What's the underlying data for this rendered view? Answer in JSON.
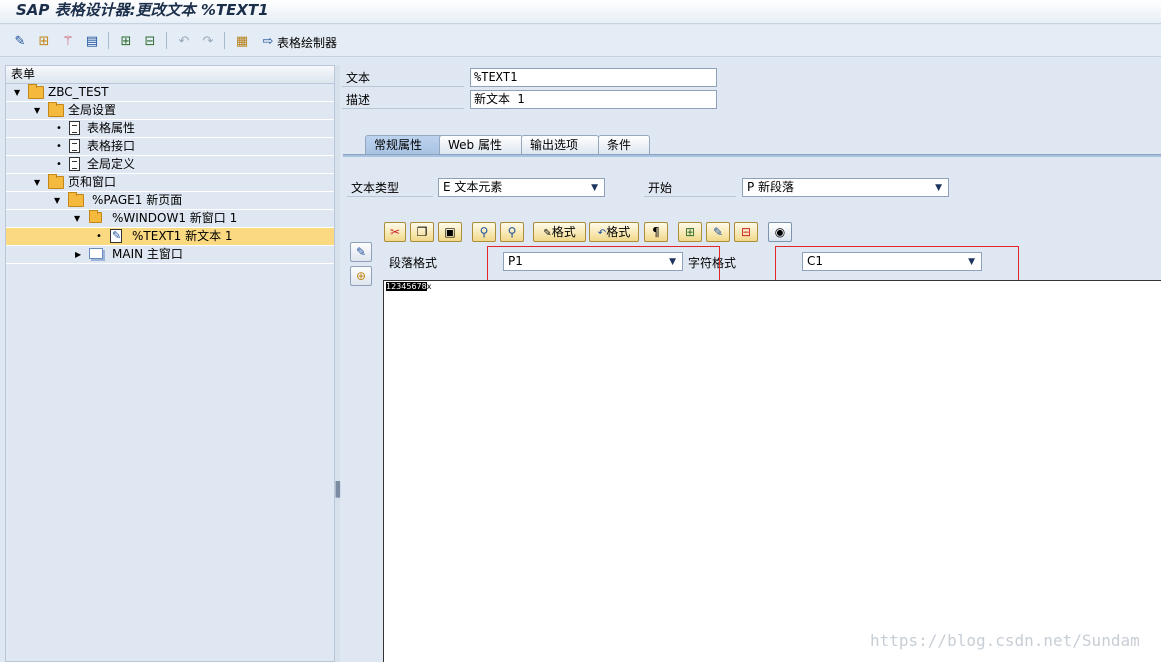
{
  "window": {
    "title": "SAP 表格设计器:更改文本 %TEXT1"
  },
  "toolbar": {
    "icons": [
      "change-icon",
      "hierarchy-icon",
      "magic-wand-icon",
      "print-preview-icon",
      "expand-icon",
      "collapse-icon",
      "undo-icon",
      "redo-icon",
      "field-list-icon"
    ],
    "form_painter_label": "表格绘制器"
  },
  "tree": {
    "header": "表单",
    "nodes": [
      {
        "label": "ZBC_TEST"
      },
      {
        "label": "全局设置"
      },
      {
        "label": "表格属性"
      },
      {
        "label": "表格接口"
      },
      {
        "label": "全局定义"
      },
      {
        "label": "页和窗口"
      },
      {
        "label": "%PAGE1 新页面"
      },
      {
        "label": "%WINDOW1 新窗口 1"
      },
      {
        "label": "%TEXT1 新文本 1"
      },
      {
        "label": "MAIN 主窗口"
      }
    ]
  },
  "header_fields": {
    "text_label": "文本",
    "text_value": "%TEXT1",
    "desc_label": "描述",
    "desc_value": "新文本 1"
  },
  "tabs": [
    {
      "label": "常规属性",
      "active": true
    },
    {
      "label": "Web 属性",
      "active": false
    },
    {
      "label": "输出选项",
      "active": false
    },
    {
      "label": "条件",
      "active": false
    }
  ],
  "general": {
    "text_type_label": "文本类型",
    "text_type_value": "E 文本元素",
    "start_label": "开始",
    "start_value": "P 新段落"
  },
  "editor_toolbar": {
    "format_label_1": "格式",
    "format_label_2": "格式",
    "paragraph_mark": "¶"
  },
  "format": {
    "paragraph_label": "段落格式",
    "paragraph_value": "P1",
    "char_label": "字符格式",
    "char_value": "C1"
  },
  "editor": {
    "selected_text": "12345678",
    "rest_text": "x"
  },
  "watermark": "https://blog.csdn.net/Sundam",
  "colors": {
    "selection": "#fbd981",
    "highlight_box": "#e02828",
    "active_tab": "#a8c2e3"
  }
}
